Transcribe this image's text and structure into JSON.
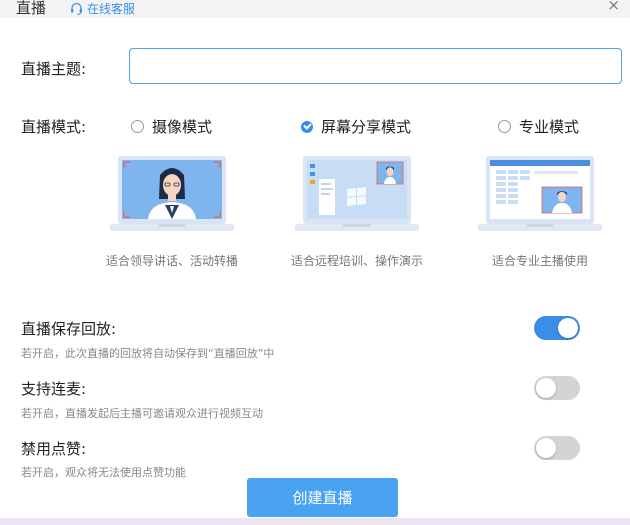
{
  "header": {
    "title": "直播",
    "support_label": "在线客服",
    "close_glyph": "×"
  },
  "form": {
    "topic_label": "直播主题:",
    "topic_value": "",
    "mode_label": "直播模式:",
    "modes": [
      {
        "label": "摄像模式",
        "selected": false,
        "caption": "适合领导讲话、活动转播"
      },
      {
        "label": "屏幕分享模式",
        "selected": true,
        "caption": "适合远程培训、操作演示"
      },
      {
        "label": "专业模式",
        "selected": false,
        "caption": "适合专业主播使用"
      }
    ]
  },
  "settings": [
    {
      "title": "直播保存回放:",
      "desc": "若开启，此次直播的回放将自动保存到“直播回放”中",
      "enabled": true
    },
    {
      "title": "支持连麦:",
      "desc": "若开启，直播发起后主播可邀请观众进行视频互动",
      "enabled": false
    },
    {
      "title": "禁用点赞:",
      "desc": "若开启，观众将无法使用点赞功能",
      "enabled": false
    }
  ],
  "actions": {
    "create_label": "创建直播"
  },
  "colors": {
    "accent": "#3a8ee6",
    "button": "#4aa3f0",
    "toggle_off": "#d4d4d6",
    "backdrop": "#ece6f4"
  }
}
